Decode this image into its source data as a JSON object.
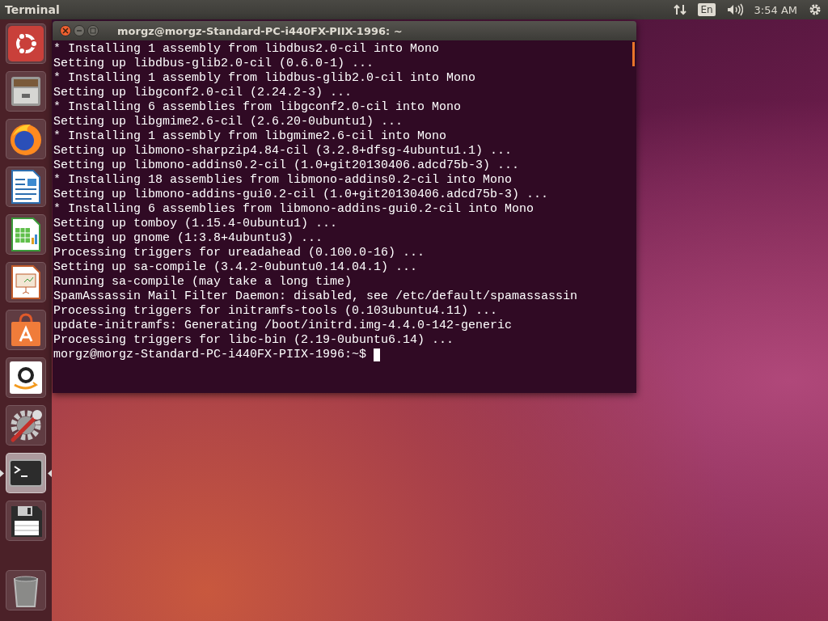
{
  "top_bar": {
    "app_title": "Terminal",
    "keyboard_layout": "En",
    "clock": "3:54 AM"
  },
  "launcher": [
    {
      "kind": "ubuntu",
      "running": false,
      "focused": false
    },
    {
      "kind": "files",
      "running": false,
      "focused": false
    },
    {
      "kind": "browser",
      "running": false,
      "focused": false
    },
    {
      "kind": "writer",
      "running": false,
      "focused": false
    },
    {
      "kind": "calc",
      "running": false,
      "focused": false
    },
    {
      "kind": "impress",
      "running": false,
      "focused": false
    },
    {
      "kind": "store",
      "running": false,
      "focused": false
    },
    {
      "kind": "amazon",
      "running": false,
      "focused": false
    },
    {
      "kind": "settings",
      "running": false,
      "focused": false
    },
    {
      "kind": "terminal",
      "running": true,
      "focused": true
    },
    {
      "kind": "floppy",
      "running": false,
      "focused": false
    },
    {
      "kind": "trash",
      "running": false,
      "focused": false
    }
  ],
  "terminal": {
    "title": "morgz@morgz-Standard-PC-i440FX-PIIX-1996: ~",
    "lines": [
      "* Installing 1 assembly from libdbus2.0-cil into Mono",
      "Setting up libdbus-glib2.0-cil (0.6.0-1) ...",
      "* Installing 1 assembly from libdbus-glib2.0-cil into Mono",
      "Setting up libgconf2.0-cil (2.24.2-3) ...",
      "* Installing 6 assemblies from libgconf2.0-cil into Mono",
      "Setting up libgmime2.6-cil (2.6.20-0ubuntu1) ...",
      "* Installing 1 assembly from libgmime2.6-cil into Mono",
      "Setting up libmono-sharpzip4.84-cil (3.2.8+dfsg-4ubuntu1.1) ...",
      "Setting up libmono-addins0.2-cil (1.0+git20130406.adcd75b-3) ...",
      "* Installing 18 assemblies from libmono-addins0.2-cil into Mono",
      "Setting up libmono-addins-gui0.2-cil (1.0+git20130406.adcd75b-3) ...",
      "* Installing 6 assemblies from libmono-addins-gui0.2-cil into Mono",
      "Setting up tomboy (1.15.4-0ubuntu1) ...",
      "Setting up gnome (1:3.8+4ubuntu3) ...",
      "Processing triggers for ureadahead (0.100.0-16) ...",
      "Setting up sa-compile (3.4.2-0ubuntu0.14.04.1) ...",
      "Running sa-compile (may take a long time)",
      "SpamAssassin Mail Filter Daemon: disabled, see /etc/default/spamassassin",
      "Processing triggers for initramfs-tools (0.103ubuntu4.11) ...",
      "update-initramfs: Generating /boot/initrd.img-4.4.0-142-generic",
      "Processing triggers for libc-bin (2.19-0ubuntu6.14) ..."
    ],
    "prompt": "morgz@morgz-Standard-PC-i440FX-PIIX-1996:~$"
  }
}
